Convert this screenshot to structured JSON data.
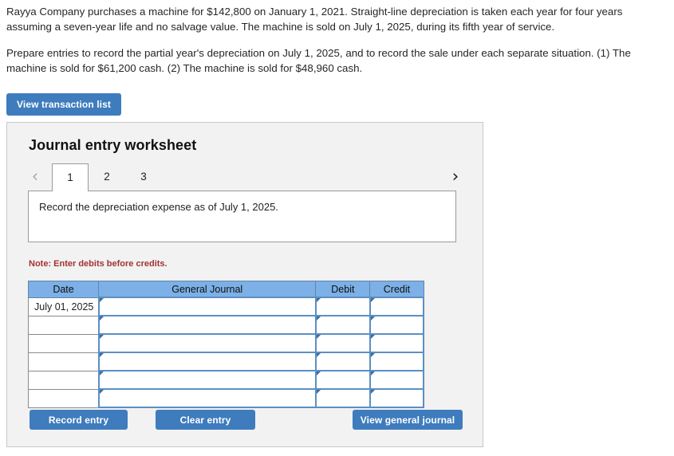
{
  "problem": {
    "paragraphs": [
      "Rayya Company purchases a machine for $142,800 on January 1, 2021. Straight-line depreciation is taken each year for four years assuming a seven-year life and no salvage value. The machine is sold on July 1, 2025, during its fifth year of service.",
      "Prepare entries to record the partial year's depreciation on July 1, 2025, and to record the sale under each separate situation. (1) The machine is sold for $61,200 cash. (2) The machine is sold for $48,960 cash."
    ]
  },
  "toolbar": {
    "view_transaction_list_label": "View transaction list"
  },
  "worksheet": {
    "title": "Journal entry worksheet",
    "prev_icon": "‹",
    "next_icon": "›",
    "tabs": [
      {
        "label": "1",
        "active": true
      },
      {
        "label": "2",
        "active": false
      },
      {
        "label": "3",
        "active": false
      }
    ],
    "instruction": "Record the depreciation expense as of July 1, 2025.",
    "note": "Note: Enter debits before credits."
  },
  "journal_table": {
    "headers": [
      "Date",
      "General Journal",
      "Debit",
      "Credit"
    ],
    "rows": [
      {
        "date": "July 01, 2025",
        "account": "",
        "debit": "",
        "credit": ""
      },
      {
        "date": "",
        "account": "",
        "debit": "",
        "credit": ""
      },
      {
        "date": "",
        "account": "",
        "debit": "",
        "credit": ""
      },
      {
        "date": "",
        "account": "",
        "debit": "",
        "credit": ""
      },
      {
        "date": "",
        "account": "",
        "debit": "",
        "credit": ""
      },
      {
        "date": "",
        "account": "",
        "debit": "",
        "credit": ""
      }
    ]
  },
  "actions": {
    "record_entry_label": "Record entry",
    "clear_entry_label": "Clear entry",
    "view_general_journal_label": "View general journal"
  },
  "colors": {
    "button_blue": "#3e7cbe",
    "table_header_blue": "#7cb0e6",
    "input_border_blue": "#5b8fc4",
    "note_red": "#a33232",
    "panel_bg": "#f2f2f2"
  }
}
